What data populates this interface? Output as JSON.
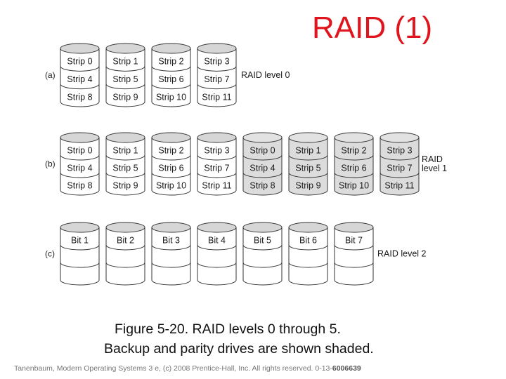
{
  "title": "RAID (1)",
  "colors": {
    "title": "#e0141c",
    "disk_body": "#ffffff",
    "disk_top": "#d6d6d6",
    "shaded_body": "#dcdcdc",
    "shaded_top": "#e2e2e2",
    "stroke": "#333333"
  },
  "diagram": {
    "rows": [
      {
        "id": "a",
        "row_label": "(a)",
        "level_label": [
          "RAID level 0"
        ],
        "disks": [
          {
            "shaded": false,
            "cells": [
              "Strip 0",
              "Strip 4",
              "Strip 8"
            ]
          },
          {
            "shaded": false,
            "cells": [
              "Strip 1",
              "Strip 5",
              "Strip 9"
            ]
          },
          {
            "shaded": false,
            "cells": [
              "Strip 2",
              "Strip 6",
              "Strip 10"
            ]
          },
          {
            "shaded": false,
            "cells": [
              "Strip 3",
              "Strip 7",
              "Strip 11"
            ]
          }
        ]
      },
      {
        "id": "b",
        "row_label": "(b)",
        "level_label": [
          "RAID",
          "level 1"
        ],
        "disks": [
          {
            "shaded": false,
            "cells": [
              "Strip 0",
              "Strip 4",
              "Strip 8"
            ]
          },
          {
            "shaded": false,
            "cells": [
              "Strip 1",
              "Strip 5",
              "Strip 9"
            ]
          },
          {
            "shaded": false,
            "cells": [
              "Strip 2",
              "Strip 6",
              "Strip 10"
            ]
          },
          {
            "shaded": false,
            "cells": [
              "Strip 3",
              "Strip 7",
              "Strip 11"
            ]
          },
          {
            "shaded": true,
            "cells": [
              "Strip 0",
              "Strip 4",
              "Strip 8"
            ]
          },
          {
            "shaded": true,
            "cells": [
              "Strip 1",
              "Strip 5",
              "Strip 9"
            ]
          },
          {
            "shaded": true,
            "cells": [
              "Strip 2",
              "Strip 6",
              "Strip 10"
            ]
          },
          {
            "shaded": true,
            "cells": [
              "Strip 3",
              "Strip 7",
              "Strip 11"
            ]
          }
        ]
      },
      {
        "id": "c",
        "row_label": "(c)",
        "level_label": [
          "RAID level 2"
        ],
        "disks": [
          {
            "shaded": false,
            "cells": [
              "Bit 1",
              "",
              ""
            ]
          },
          {
            "shaded": false,
            "cells": [
              "Bit 2",
              "",
              ""
            ]
          },
          {
            "shaded": false,
            "cells": [
              "Bit 3",
              "",
              ""
            ]
          },
          {
            "shaded": false,
            "cells": [
              "Bit 4",
              "",
              ""
            ]
          },
          {
            "shaded": false,
            "cells": [
              "Bit 5",
              "",
              ""
            ]
          },
          {
            "shaded": false,
            "cells": [
              "Bit 6",
              "",
              ""
            ]
          },
          {
            "shaded": false,
            "cells": [
              "Bit 7",
              "",
              ""
            ]
          }
        ]
      }
    ]
  },
  "caption": {
    "line1": "Figure 5-20. RAID levels 0 through 5.",
    "line2": "Backup and parity drives are shown shaded."
  },
  "credit": {
    "text": "Tanenbaum, Modern Operating Systems 3 e, (c) 2008 Prentice-Hall, Inc. All rights reserved. 0-13-",
    "isbn_tail": "6006639"
  }
}
